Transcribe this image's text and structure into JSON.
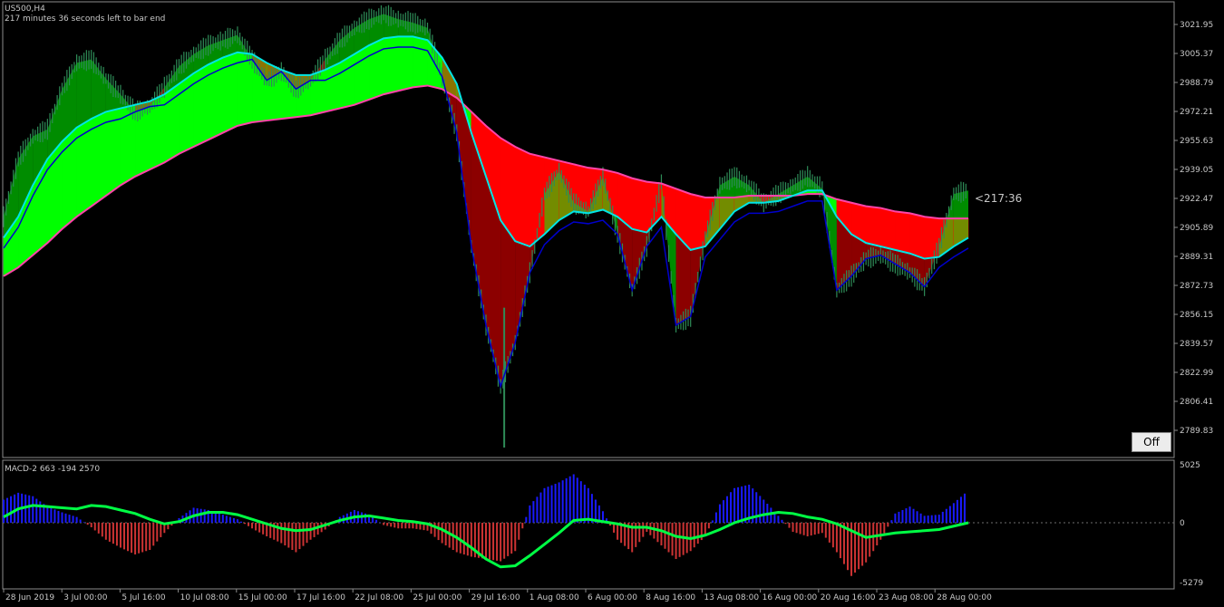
{
  "header": {
    "symbol": "US500,H4",
    "countdown": "217 minutes 36 seconds left to bar end"
  },
  "timer_label": "<217:36",
  "off_button": "Off",
  "macd_label": "MACD-2 663 -194 2570",
  "colors": {
    "background": "#000000",
    "bull_fill": "#00ff00",
    "bear_fill": "#ff0000",
    "ema_fast": "#00e5e5",
    "ema_slow": "#ff44aa",
    "stop_line_up": "#0000cc",
    "stop_line_dn": "#ff33cc",
    "candle": "#2e8b57",
    "hist_pos": "#1a1aff",
    "hist_neg": "#cc3333",
    "macd_signal_pos": "#00ff44",
    "macd_signal_neg": "#ff3399"
  },
  "chart_data": [
    {
      "type": "line",
      "title": "US500,H4",
      "ylim": [
        2780,
        3035
      ],
      "y_ticks": [
        "3021.95",
        "3005.37",
        "2988.79",
        "2972.21",
        "2955.63",
        "2939.05",
        "2922.47",
        "2905.89",
        "2889.31",
        "2872.73",
        "2856.15",
        "2839.57",
        "2822.99",
        "2806.41",
        "2789.83"
      ],
      "x_ticks": [
        "28 Jun 2019",
        "3 Jul 00:00",
        "5 Jul 16:00",
        "10 Jul 08:00",
        "15 Jul 00:00",
        "17 Jul 16:00",
        "22 Jul 08:00",
        "25 Jul 00:00",
        "29 Jul 16:00",
        "1 Aug 08:00",
        "6 Aug 00:00",
        "8 Aug 16:00",
        "13 Aug 08:00",
        "16 Aug 00:00",
        "20 Aug 16:00",
        "23 Aug 08:00",
        "28 Aug 00:00"
      ],
      "x": [
        0,
        4,
        8,
        12,
        16,
        20,
        24,
        28,
        32,
        36,
        40,
        44,
        48,
        52,
        56,
        60,
        64,
        68,
        72,
        76,
        80,
        84,
        88,
        92,
        96,
        100,
        104,
        108,
        112,
        116,
        120,
        124,
        128,
        132,
        136,
        140,
        144,
        148,
        152,
        156,
        160,
        164,
        168,
        172,
        176,
        180,
        184,
        188,
        192,
        196,
        200,
        204,
        208,
        212,
        216,
        220,
        224,
        228,
        232,
        236,
        240,
        244,
        248,
        252,
        256,
        260,
        264
      ],
      "series": [
        {
          "name": "price",
          "values": [
            2912,
            2945,
            2958,
            2962,
            2985,
            3000,
            3002,
            2991,
            2982,
            2972,
            2975,
            2986,
            2998,
            3005,
            3010,
            3013,
            3016,
            3002,
            2990,
            2995,
            2985,
            2990,
            3002,
            3013,
            3020,
            3025,
            3028,
            3025,
            3023,
            3020,
            2992,
            2960,
            2895,
            2850,
            2815,
            2840,
            2880,
            2925,
            2938,
            2920,
            2915,
            2935,
            2902,
            2870,
            2895,
            2932,
            2850,
            2855,
            2900,
            2930,
            2935,
            2930,
            2920,
            2925,
            2930,
            2935,
            2928,
            2870,
            2878,
            2888,
            2890,
            2885,
            2880,
            2872,
            2895,
            2925,
            2927
          ]
        },
        {
          "values": [
            2900,
            2912,
            2930,
            2945,
            2955,
            2963,
            2968,
            2972,
            2974,
            2976,
            2978,
            2982,
            2988,
            2994,
            2999,
            3003,
            3006,
            3005,
            3000,
            2996,
            2993,
            2993,
            2996,
            3000,
            3005,
            3010,
            3014,
            3015,
            3015,
            3013,
            3003,
            2988,
            2960,
            2935,
            2910,
            2898,
            2895,
            2902,
            2910,
            2915,
            2914,
            2916,
            2912,
            2905,
            2903,
            2912,
            2902,
            2893,
            2895,
            2905,
            2915,
            2920,
            2920,
            2921,
            2924,
            2927,
            2927,
            2912,
            2902,
            2897,
            2895,
            2893,
            2891,
            2888,
            2889,
            2895,
            2900
          ]
        },
        {
          "values": [
            2878,
            2883,
            2890,
            2897,
            2905,
            2912,
            2918,
            2924,
            2930,
            2935,
            2939,
            2943,
            2948,
            2952,
            2956,
            2960,
            2964,
            2966,
            2967,
            2968,
            2969,
            2970,
            2972,
            2974,
            2976,
            2979,
            2982,
            2984,
            2986,
            2987,
            2985,
            2980,
            2972,
            2964,
            2957,
            2952,
            2948,
            2946,
            2944,
            2942,
            2940,
            2939,
            2937,
            2934,
            2932,
            2931,
            2928,
            2925,
            2923,
            2923,
            2923,
            2924,
            2924,
            2924,
            2924,
            2925,
            2925,
            2922,
            2920,
            2918,
            2917,
            2915,
            2914,
            2912,
            2911,
            2911,
            2911
          ]
        }
      ]
    },
    {
      "type": "bar",
      "title": "MACD-2 663 -194 2570",
      "ylim": [
        -5279,
        5025
      ],
      "y_ticks": [
        "5025",
        "0",
        "-5279"
      ],
      "x": [
        0,
        4,
        8,
        12,
        16,
        20,
        24,
        28,
        32,
        36,
        40,
        44,
        48,
        52,
        56,
        60,
        64,
        68,
        72,
        76,
        80,
        84,
        88,
        92,
        96,
        100,
        104,
        108,
        112,
        116,
        120,
        124,
        128,
        132,
        136,
        140,
        144,
        148,
        152,
        156,
        160,
        164,
        168,
        172,
        176,
        180,
        184,
        188,
        192,
        196,
        200,
        204,
        208,
        212,
        216,
        220,
        224,
        228,
        232,
        236,
        240,
        244,
        248,
        252,
        256,
        260,
        264
      ],
      "series": [
        {
          "name": "histogram",
          "values": [
            2000,
            2600,
            2300,
            1400,
            900,
            500,
            -400,
            -1500,
            -2200,
            -2800,
            -2400,
            -900,
            400,
            1300,
            1100,
            700,
            300,
            -500,
            -1200,
            -1800,
            -2600,
            -1500,
            -600,
            500,
            1100,
            700,
            -200,
            -500,
            -500,
            -700,
            -1800,
            -2600,
            -3000,
            -3200,
            -3400,
            -2500,
            1500,
            3000,
            3500,
            4200,
            3000,
            1000,
            -1500,
            -2600,
            -800,
            -2000,
            -3200,
            -2500,
            -1200,
            1600,
            3000,
            3300,
            2000,
            600,
            -800,
            -1200,
            -900,
            -2600,
            -4700,
            -3500,
            -1500,
            800,
            1400,
            600,
            700,
            1700,
            2800
          ]
        },
        {
          "name": "signal",
          "values": [
            500,
            1200,
            1500,
            1400,
            1300,
            1200,
            1500,
            1400,
            1100,
            800,
            300,
            -100,
            100,
            600,
            900,
            900,
            700,
            300,
            -100,
            -500,
            -700,
            -600,
            -200,
            200,
            500,
            600,
            400,
            200,
            100,
            -100,
            -600,
            -1300,
            -2200,
            -3200,
            -3900,
            -3800,
            -2900,
            -1900,
            -900,
            200,
            300,
            100,
            -100,
            -400,
            -400,
            -700,
            -1200,
            -1400,
            -1100,
            -600,
            0,
            400,
            700,
            900,
            800,
            500,
            300,
            -100,
            -700,
            -1300,
            -1100,
            -900,
            -800,
            -700,
            -600,
            -300,
            0
          ]
        }
      ]
    }
  ]
}
